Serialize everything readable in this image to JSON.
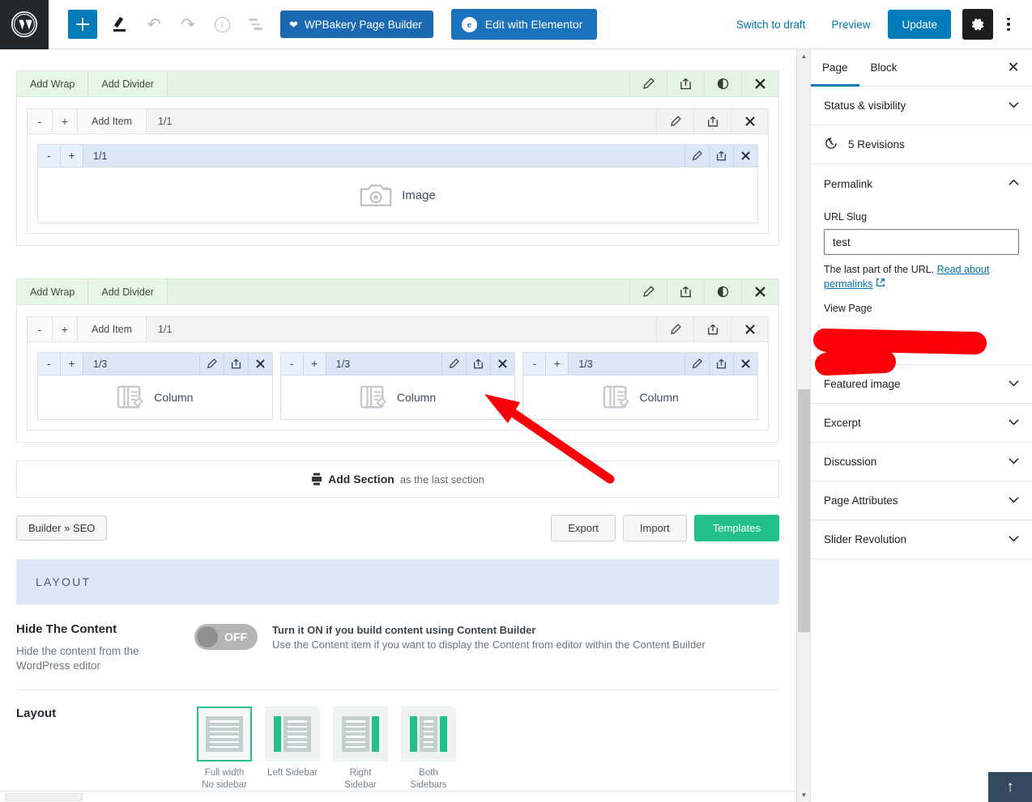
{
  "toolbar": {
    "wp_logo": "wordpress-logo",
    "add_block_label": "+",
    "edit_tool_label": "edit-tool",
    "undo_label": "undo",
    "redo_label": "redo",
    "info_label": "details",
    "list_view_label": "list-view",
    "wpbakery_label": "WPBakery Page Builder",
    "elementor_label": "Edit with Elementor",
    "elementor_badge": "e",
    "switch_draft_label": "Switch to draft",
    "preview_label": "Preview",
    "update_label": "Update",
    "settings_label": "settings-gear",
    "more_label": "more-options"
  },
  "sidebar": {
    "tabs": [
      {
        "label": "Page",
        "active": true
      },
      {
        "label": "Block",
        "active": false
      }
    ],
    "close_label": "✕",
    "status_visibility": "Status & visibility",
    "revisions": "5 Revisions",
    "permalink": "Permalink",
    "url_slug_label": "URL Slug",
    "url_slug_value": "test",
    "url_slug_placeholder": "test",
    "help_text": "The last part of the URL.",
    "help_link": "Read about permalinks",
    "view_page_label": "View Page",
    "redacted_note": "",
    "panels": [
      "Featured image",
      "Excerpt",
      "Discussion",
      "Page Attributes",
      "Slider Revolution"
    ],
    "chevron_down": "⌄",
    "chevron_up": "⌃"
  },
  "builder": {
    "sections": [
      {
        "head_tabs": [
          "Add Wrap",
          "Add Divider"
        ],
        "icons": [
          "pencil-icon",
          "export-icon",
          "eye-icon",
          "close-icon"
        ],
        "item": {
          "minus": "-",
          "plus": "+",
          "add_item": "Add Item",
          "ratio": "1/1",
          "icons": [
            "pencil-icon",
            "export-icon",
            "close-icon"
          ],
          "columns": [
            {
              "minus": "-",
              "plus": "+",
              "ratio": "1/1",
              "label": "Image",
              "icon": "camera-icon"
            }
          ]
        }
      },
      {
        "head_tabs": [
          "Add Wrap",
          "Add Divider"
        ],
        "icons": [
          "pencil-icon",
          "export-icon",
          "eye-icon",
          "close-icon"
        ],
        "item": {
          "minus": "-",
          "plus": "+",
          "add_item": "Add Item",
          "ratio": "1/1",
          "icons": [
            "pencil-icon",
            "export-icon",
            "close-icon"
          ],
          "columns": [
            {
              "minus": "-",
              "plus": "+",
              "ratio": "1/3",
              "label": "Column",
              "icon": "column-icon"
            },
            {
              "minus": "-",
              "plus": "+",
              "ratio": "1/3",
              "label": "Column",
              "icon": "column-icon"
            },
            {
              "minus": "-",
              "plus": "+",
              "ratio": "1/3",
              "label": "Column",
              "icon": "column-icon"
            }
          ]
        }
      }
    ],
    "add_section_strong": "Add Section",
    "add_section_muted": "as the last section",
    "footer": {
      "builder_seo": "Builder » SEO",
      "export": "Export",
      "import": "Import",
      "templates": "Templates"
    }
  },
  "layout_panel": {
    "banner_title": "LAYOUT",
    "hide_content": {
      "title": "Hide The Content",
      "desc": "Hide the content from the WordPress editor",
      "toggle_state": "OFF",
      "help_line1": "Turn it ON if you build content using Content Builder",
      "help_line2": "Use the Content item if you want to display the Content from editor within the Content Builder"
    },
    "layout": {
      "title": "Layout",
      "options": [
        {
          "caption": "Full width\nNo sidebar",
          "selected": true,
          "bars": "none"
        },
        {
          "caption": "Left Sidebar",
          "selected": false,
          "bars": "left"
        },
        {
          "caption": "Right\nSidebar",
          "selected": false,
          "bars": "right"
        },
        {
          "caption": "Both\nSidebars",
          "selected": false,
          "bars": "both"
        }
      ]
    }
  },
  "to_top_label": "↑",
  "colors": {
    "wp_admin_dark": "#23282d",
    "accent_blue": "#007cba",
    "elementor_blue": "#1b72bc",
    "wpbakery_blue": "#1b68b3",
    "teal": "#23c08b",
    "section_green": "#e4f4e4",
    "column_blue": "#dce7f5",
    "banner_blue": "#dde7f5",
    "annotation_red": "#fb0006",
    "to_top_navy": "#34495e"
  }
}
